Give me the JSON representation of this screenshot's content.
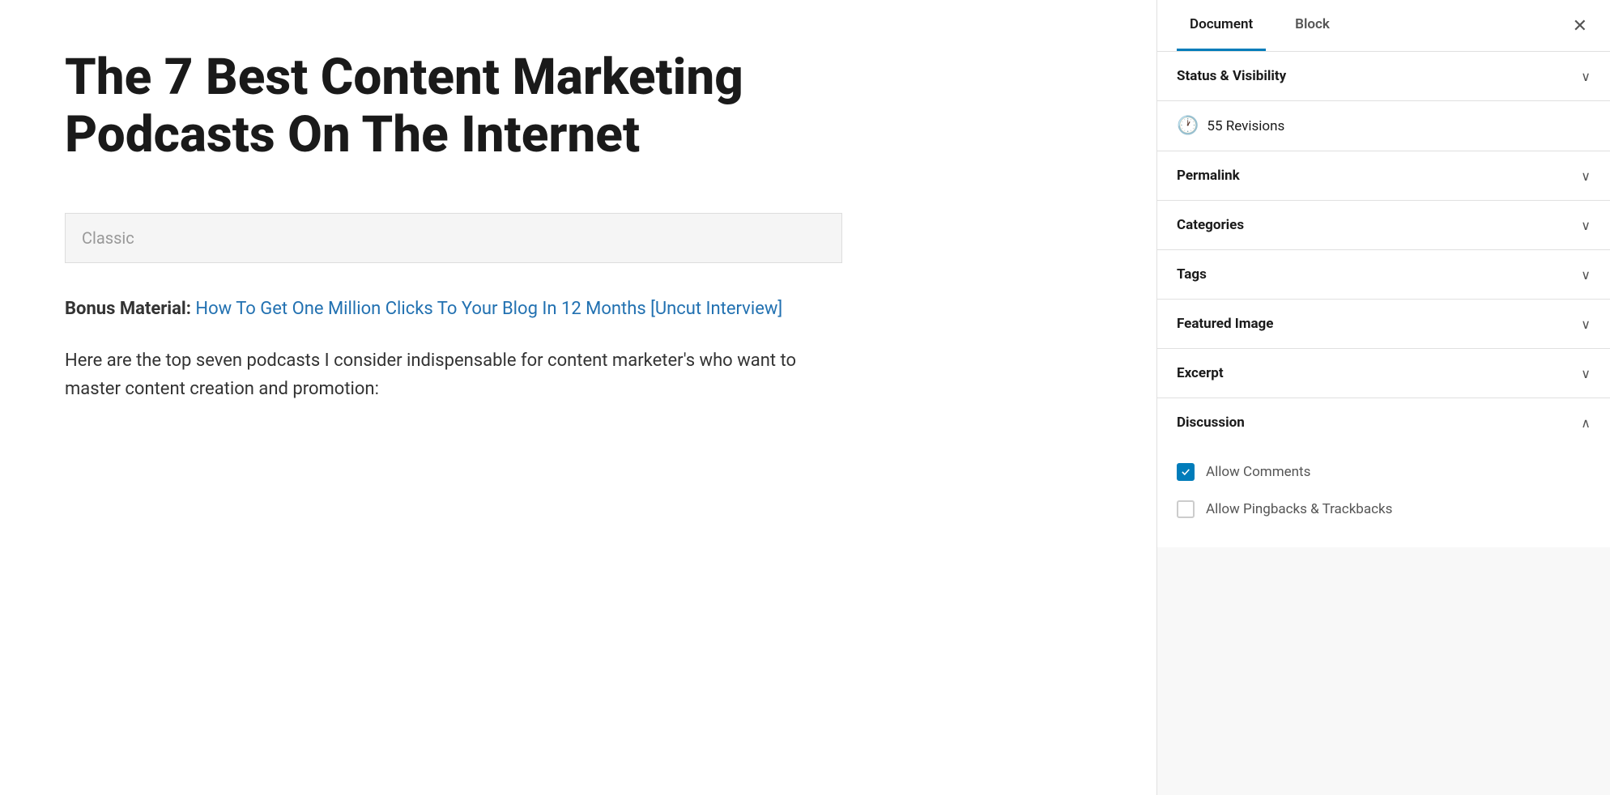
{
  "main": {
    "post_title": "The 7 Best Content Marketing Podcasts On The Internet",
    "classic_block_label": "Classic",
    "bonus_material_prefix": "Bonus Material:",
    "bonus_material_link": "How To Get One Million Clicks To Your Blog In 12 Months [Uncut Interview]",
    "body_text": "Here are the top seven podcasts I consider indispensable for content marketer's who want to master content creation and promotion:"
  },
  "sidebar": {
    "tab_document": "Document",
    "tab_block": "Block",
    "close_icon": "✕",
    "panels": [
      {
        "id": "status-visibility",
        "label": "Status & Visibility",
        "open": false,
        "chevron": "down"
      },
      {
        "id": "revisions",
        "label": "55 Revisions",
        "is_revisions": true
      },
      {
        "id": "permalink",
        "label": "Permalink",
        "open": false,
        "chevron": "down"
      },
      {
        "id": "categories",
        "label": "Categories",
        "open": false,
        "chevron": "down"
      },
      {
        "id": "tags",
        "label": "Tags",
        "open": false,
        "chevron": "down"
      },
      {
        "id": "featured-image",
        "label": "Featured Image",
        "open": false,
        "chevron": "down"
      },
      {
        "id": "excerpt",
        "label": "Excerpt",
        "open": false,
        "chevron": "down"
      }
    ],
    "discussion": {
      "label": "Discussion",
      "open": true,
      "chevron": "up",
      "checkboxes": [
        {
          "id": "allow-comments",
          "label": "Allow Comments",
          "checked": true
        },
        {
          "id": "allow-pingbacks",
          "label": "Allow Pingbacks & Trackbacks",
          "checked": false
        }
      ]
    }
  }
}
